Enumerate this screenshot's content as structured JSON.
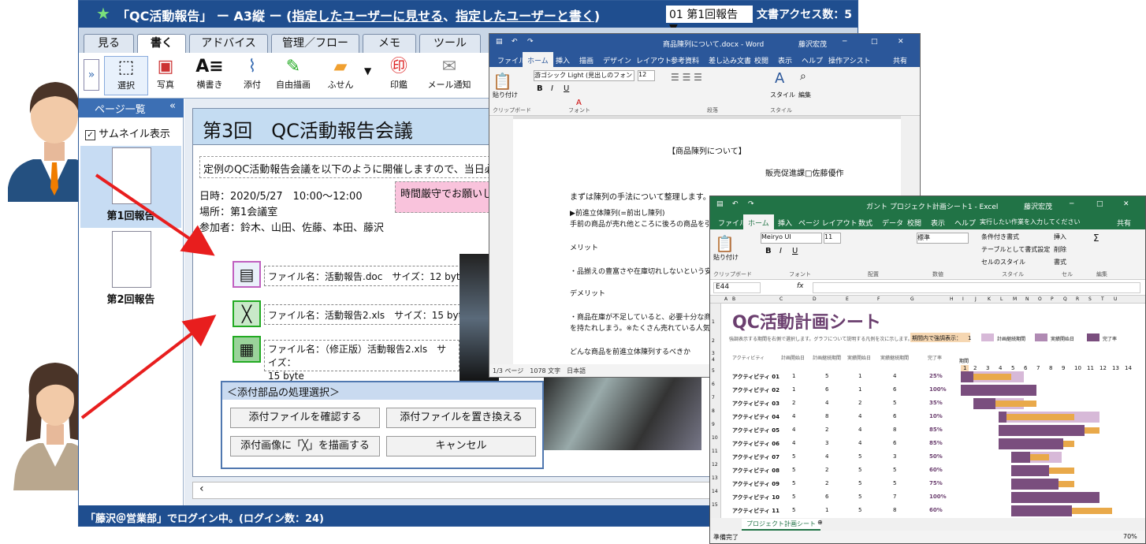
{
  "app": {
    "title_prefix": "「QC活動報告」 ー A3縦 ー (",
    "title_link1": "指定したユーザーに見せる",
    "title_mid": "、",
    "title_link2": "指定したユーザーと書く",
    "title_suffix": ")",
    "doc_select": "01 第1回報告 ▼",
    "access_count": "文書アクセス数：5",
    "tabs": [
      "見る",
      "書く",
      "アドバイス",
      "管理／フロー",
      "メモ",
      "ツール"
    ],
    "toolbar": [
      "選択",
      "写真",
      "横書き",
      "添付",
      "自由描画",
      "ふせん",
      "印鑑",
      "メール通知"
    ],
    "sidebar": {
      "header": "ページ一覧",
      "collapse": "«",
      "thumb_toggle": "サムネイル表示",
      "pages": [
        "第1回報告",
        "第2回報告"
      ]
    },
    "doc": {
      "heading": "第3回　QC活動報告会議",
      "intro": "定例のQC活動報告会議を以下のように開催しますので、当日必要な",
      "datetime": "日時：2020/5/27　10:00〜12:00",
      "place": "場所：第1会議室",
      "attendees": "参加者：鈴木、山田、佐藤、本田、藤沢",
      "note": "時間厳守でお願いしま",
      "files": [
        "ファイル名：活動報告.doc　サイズ：12 byte",
        "ファイル名：活動報告2.xls　サイズ：15 byte",
        "ファイル名：（修正版）活動報告2.xls　サイズ：",
        "15 byte"
      ]
    },
    "dialog": {
      "title": "＜添付部品の処理選択＞",
      "buttons": [
        "添付ファイルを確認する",
        "添付ファイルを置き換える",
        "添付画像に「╳」を描画する",
        "キャンセル"
      ]
    },
    "status": "「藤沢＠営業部」でログイン中。(ログイン数：24)"
  },
  "word": {
    "title": "商品陳列について.docx - Word",
    "user": "藤沢宏茂",
    "tabs": [
      "ファイル",
      "ホーム",
      "挿入",
      "描画",
      "デザイン",
      "レイアウト",
      "参考資料",
      "差し込み文書",
      "校閲",
      "表示",
      "ヘルプ",
      "操作アシスト",
      "共有"
    ],
    "font": "游ゴシック Light (見出しのフォン",
    "size": "12",
    "groups": [
      "クリップボード",
      "フォント",
      "段落",
      "スタイル"
    ],
    "paste": "貼り付け",
    "style_btn": "スタイル",
    "edit_btn": "編集",
    "lines": [
      "【商品陳列について】",
      "販売促進課□佐藤優作",
      "まずは陳列の手法について整理します。",
      "▶前進立体陳列(=前出し陳列)",
      "手前の商品が売れ他ところに後ろの商品を引き",
      "メリット",
      "・品揃えの豊富さや在庫切れしないという安心",
      "デメリット",
      "・商品在庫が不足していると、必要十分な商品",
      "を持たれしまう。※たくさん売れている人気",
      "どんな商品を前進立体陳列するべきか"
    ],
    "status": [
      "1/3 ページ",
      "1078 文字",
      "日本語"
    ]
  },
  "excel": {
    "title": "ガント プロジェクト計画シート1 - Excel",
    "user": "藤沢宏茂",
    "tabs": [
      "ファイル",
      "ホーム",
      "挿入",
      "ページ レイアウト",
      "数式",
      "データ",
      "校閲",
      "表示",
      "ヘルプ",
      "実行したい作業を入力してください",
      "共有"
    ],
    "font": "Meiryo UI",
    "size": "11",
    "number_format": "標準",
    "cell": "E44",
    "groups": [
      "クリップボード",
      "フォント",
      "配置",
      "数値",
      "スタイル",
      "セル",
      "編集"
    ],
    "ribbon_items": [
      "条件付き書式",
      "テーブルとして書式設定",
      "セルのスタイル",
      "挿入",
      "削除",
      "書式",
      "貼り付け"
    ],
    "sheet_title": "QC活動計画シート",
    "hint": "強調表示する期間を右側で選択します。グラフについて説明する凡例を次に示します。",
    "period_label": "期間内で強調表示：",
    "period_value": "1",
    "legend": [
      "計画継続期間",
      "実績開始日",
      "完了率"
    ],
    "headers": [
      "アクティビティ",
      "計画開始日",
      "計画継続期間",
      "実績開始日",
      "実績継続期間",
      "完了率"
    ],
    "period_header": "期間",
    "cols": [
      "A",
      "B",
      "C",
      "D",
      "E",
      "F",
      "G",
      "H",
      "I",
      "J",
      "K",
      "L",
      "M",
      "N",
      "O",
      "P",
      "Q",
      "R",
      "S",
      "T",
      "U"
    ],
    "periods": [
      "1",
      "2",
      "3",
      "4",
      "5",
      "6",
      "7",
      "8",
      "9",
      "10",
      "11",
      "12",
      "13",
      "14"
    ],
    "rows": [
      {
        "n": "アクティビティ 01",
        "ps": 1,
        "pd": 5,
        "as": 1,
        "ad": 4,
        "pct": "25%"
      },
      {
        "n": "アクティビティ 02",
        "ps": 1,
        "pd": 6,
        "as": 1,
        "ad": 6,
        "pct": "100%"
      },
      {
        "n": "アクティビティ 03",
        "ps": 2,
        "pd": 4,
        "as": 2,
        "ad": 5,
        "pct": "35%"
      },
      {
        "n": "アクティビティ 04",
        "ps": 4,
        "pd": 8,
        "as": 4,
        "ad": 6,
        "pct": "10%"
      },
      {
        "n": "アクティビティ 05",
        "ps": 4,
        "pd": 2,
        "as": 4,
        "ad": 8,
        "pct": "85%"
      },
      {
        "n": "アクティビティ 06",
        "ps": 4,
        "pd": 3,
        "as": 4,
        "ad": 6,
        "pct": "85%"
      },
      {
        "n": "アクティビティ 07",
        "ps": 5,
        "pd": 4,
        "as": 5,
        "ad": 3,
        "pct": "50%"
      },
      {
        "n": "アクティビティ 08",
        "ps": 5,
        "pd": 2,
        "as": 5,
        "ad": 5,
        "pct": "60%"
      },
      {
        "n": "アクティビティ 09",
        "ps": 5,
        "pd": 2,
        "as": 5,
        "ad": 5,
        "pct": "75%"
      },
      {
        "n": "アクティビティ 10",
        "ps": 5,
        "pd": 6,
        "as": 5,
        "ad": 7,
        "pct": "100%"
      },
      {
        "n": "アクティビティ 11",
        "ps": 5,
        "pd": 1,
        "as": 5,
        "ad": 8,
        "pct": "60%"
      }
    ],
    "row_nums": [
      "1",
      "2",
      "3",
      "4",
      "5",
      "6",
      "7",
      "8",
      "9",
      "10",
      "11",
      "12",
      "13",
      "14",
      "15"
    ],
    "sheet_tab": "プロジェクト計画シート",
    "status": "準備完了",
    "zoom": "70%"
  },
  "colors": {
    "word": "#2b579a",
    "excel": "#217346",
    "app": "#1f4e8f",
    "plan": "#d7b9d8",
    "actual": "#7a4e7e",
    "complete": "#e9a94a"
  }
}
